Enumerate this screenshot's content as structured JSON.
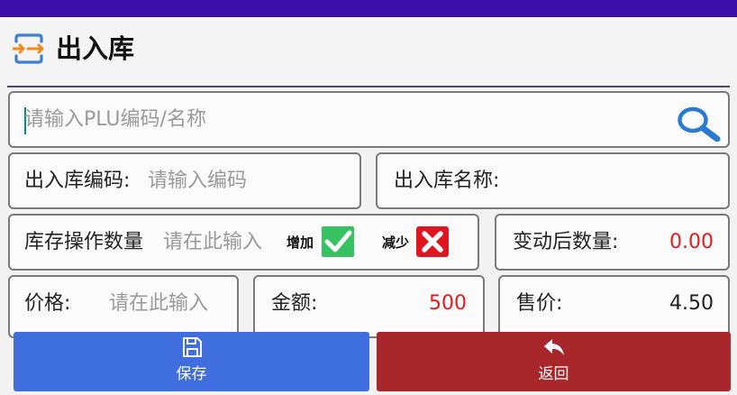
{
  "header": {
    "title": "出入库"
  },
  "search": {
    "placeholder": "请输入PLU编码/名称"
  },
  "form": {
    "code_label": "出入库编码:",
    "code_placeholder": "请输入编码",
    "name_label": "出入库名称:",
    "name_value": "",
    "qty_label": "库存操作数量",
    "qty_placeholder": "请在此输入",
    "increase_label": "增加",
    "decrease_label": "减少",
    "after_qty_label": "变动后数量:",
    "after_qty_value": "0.00",
    "price_label": "价格:",
    "price_placeholder": "请在此输入",
    "amount_label": "金额:",
    "amount_value": "500",
    "sale_price_label": "售价:",
    "sale_price_value": "4.50"
  },
  "buttons": {
    "save": "保存",
    "back": "返回"
  },
  "colors": {
    "status_bar": "#3a0ea8",
    "save_button": "#3f6fde",
    "back_button": "#a8272b",
    "red_value": "#e21b1b",
    "check_green": "#36c260",
    "cross_red": "#e0141e",
    "search_icon": "#2a7ad2"
  },
  "icons": {
    "title": "transfer-arrows-icon",
    "search": "search-icon",
    "increase": "check-icon",
    "decrease": "close-icon",
    "save": "floppy-disk-icon",
    "back": "reply-arrow-icon"
  }
}
